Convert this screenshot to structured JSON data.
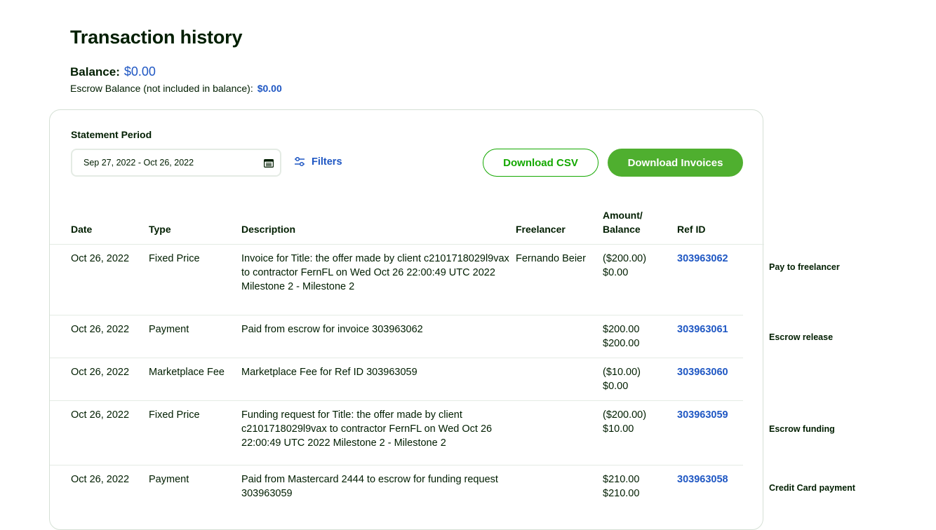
{
  "page_title": "Transaction history",
  "balance": {
    "label": "Balance:",
    "value": "$0.00"
  },
  "escrow": {
    "label": "Escrow Balance (not included in balance):",
    "value": "$0.00"
  },
  "statement": {
    "label": "Statement Period",
    "date_range": "Sep 27, 2022 - Oct 26, 2022",
    "filters_label": "Filters",
    "download_csv": "Download CSV",
    "download_invoices": "Download Invoices"
  },
  "table": {
    "headers": {
      "date": "Date",
      "type": "Type",
      "description": "Description",
      "freelancer": "Freelancer",
      "amount_1": "Amount/",
      "amount_2": "Balance",
      "ref": "Ref ID"
    },
    "rows": [
      {
        "date": "Oct 26, 2022",
        "type": "Fixed Price",
        "desc": [
          "Invoice for Title: the offer made by client c2101718029l9vax",
          "to contractor FernFL on Wed Oct 26 22:00:49 UTC 2022",
          "Milestone 2 -  Milestone 2"
        ],
        "freelancer": "Fernando Beier",
        "amount": "($200.00)",
        "balance": "$0.00",
        "ref": "303963062",
        "note": "Pay to freelancer"
      },
      {
        "date": "Oct 26, 2022",
        "type": "Payment",
        "desc": [
          "Paid from escrow for invoice 303963062"
        ],
        "freelancer": "",
        "amount": "$200.00",
        "balance": "$200.00",
        "ref": "303963061",
        "note": "Escrow release"
      },
      {
        "date": "Oct 26, 2022",
        "type": "Marketplace Fee",
        "desc": [
          "Marketplace Fee for Ref ID 303963059"
        ],
        "freelancer": "",
        "amount": "($10.00)",
        "balance": "$0.00",
        "ref": "303963060",
        "note": ""
      },
      {
        "date": "Oct 26, 2022",
        "type": "Fixed Price",
        "desc": [
          "Funding request for Title: the offer made by client",
          "c2101718029l9vax to contractor FernFL on Wed Oct 26",
          "22:00:49 UTC 2022  Milestone 2 -  Milestone 2"
        ],
        "freelancer": "",
        "amount": "($200.00)",
        "balance": "$10.00",
        "ref": "303963059",
        "note": "Escrow funding"
      },
      {
        "date": "Oct 26, 2022",
        "type": "Payment",
        "desc": [
          "Paid from Mastercard 2444 to escrow for funding request",
          "303963059"
        ],
        "freelancer": "",
        "amount": "$210.00",
        "balance": "$210.00",
        "ref": "303963058",
        "note": "Credit Card payment"
      }
    ]
  },
  "colors": {
    "accent_green": "#14a800",
    "button_green": "#4faf2f",
    "link_blue": "#1f57c3",
    "text": "#001e00"
  }
}
